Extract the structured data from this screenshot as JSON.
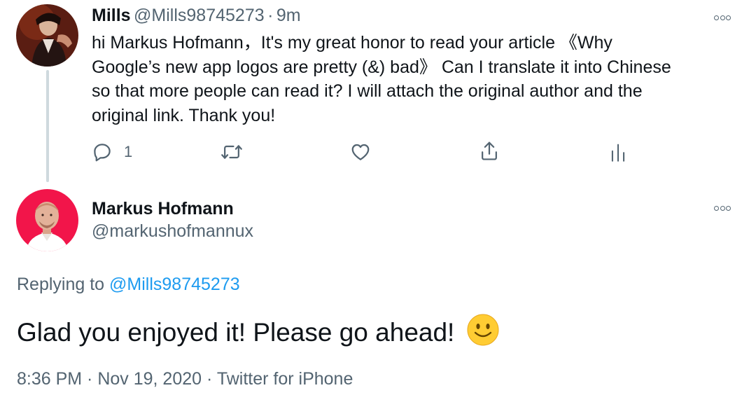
{
  "tweet": {
    "author_name": "Mills",
    "author_handle": "@Mills98745273",
    "separator": "·",
    "time": "9m",
    "body_lines": [
      "hi Markus Hofmann，It's my great honor to read your article 《Why",
      "Google’s new app logos are pretty (&) bad》 Can I translate it into Chinese",
      "so that more people can read it?  I will attach the original author and the",
      "original link. Thank you!"
    ],
    "reply_count": "1",
    "icons": {
      "more": "more-icon",
      "reply": "reply-icon",
      "retweet": "retweet-icon",
      "like": "like-icon",
      "share": "share-icon",
      "analytics": "analytics-icon"
    }
  },
  "reply": {
    "author_name": "Markus Hofmann",
    "author_handle": "@markushofmannux",
    "replying_prefix": "Replying to ",
    "replying_handle": "@Mills98745273",
    "text": "Glad you enjoyed it! Please go ahead!",
    "emoji": "smiling-face-emoji",
    "timestamp": "8:36 PM · Nov 19, 2020",
    "separator": "·",
    "source": "Twitter for iPhone"
  },
  "colors": {
    "link": "#1d9bf0",
    "muted": "#536471",
    "text": "#0f1419",
    "thread_line": "#cfd9de"
  }
}
